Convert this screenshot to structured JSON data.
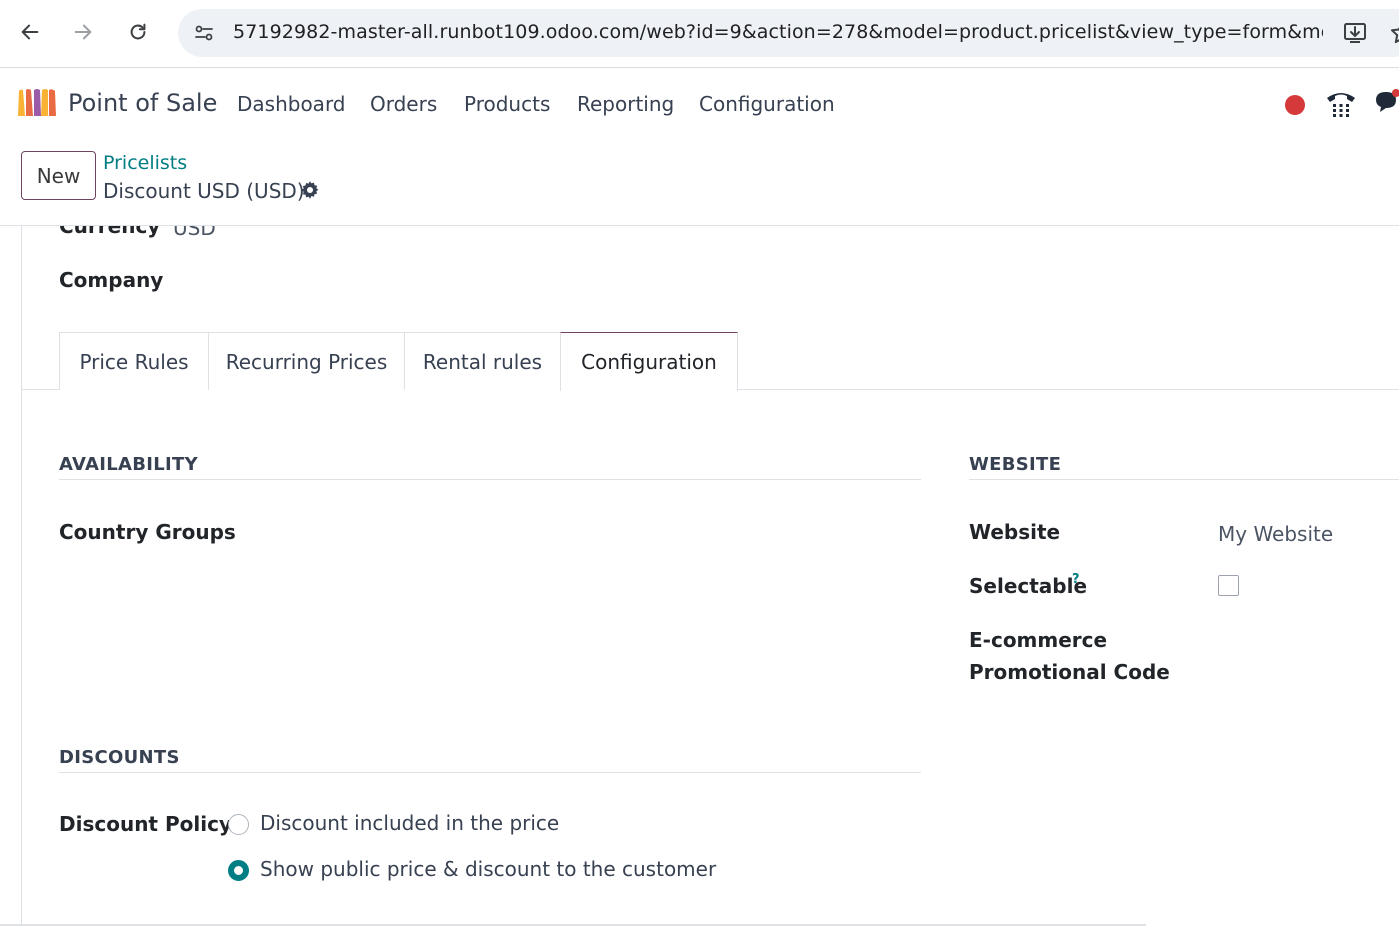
{
  "browser": {
    "url": "57192982-master-all.runbot109.odoo.com/web?id=9&action=278&model=product.pricelist&view_type=form&men..."
  },
  "navbar": {
    "app_name": "Point of Sale",
    "menu": [
      "Dashboard",
      "Orders",
      "Products",
      "Reporting",
      "Configuration"
    ]
  },
  "control_panel": {
    "new_button": "New",
    "breadcrumb": "Pricelists",
    "record_title": "Discount USD (USD)"
  },
  "form": {
    "currency_label": "Currency",
    "currency_value": "USD",
    "company_label": "Company",
    "tabs": [
      "Price Rules",
      "Recurring Prices",
      "Rental rules",
      "Configuration"
    ],
    "active_tab": "Configuration",
    "availability": {
      "title": "AVAILABILITY",
      "country_groups_label": "Country Groups"
    },
    "website": {
      "title": "WEBSITE",
      "website_label": "Website",
      "website_value": "My Website",
      "selectable_label": "Selectable",
      "selectable_help": "?",
      "selectable_checked": false,
      "promo_label_line1": "E-commerce",
      "promo_label_line2": "Promotional Code"
    },
    "discounts": {
      "title": "DISCOUNTS",
      "policy_label": "Discount Policy",
      "options": [
        "Discount included in the price",
        "Show public price & discount to the customer"
      ],
      "selected_index": 1
    }
  },
  "colors": {
    "accent": "#017e84",
    "brand": "#71435e",
    "notification": "#d63939"
  }
}
